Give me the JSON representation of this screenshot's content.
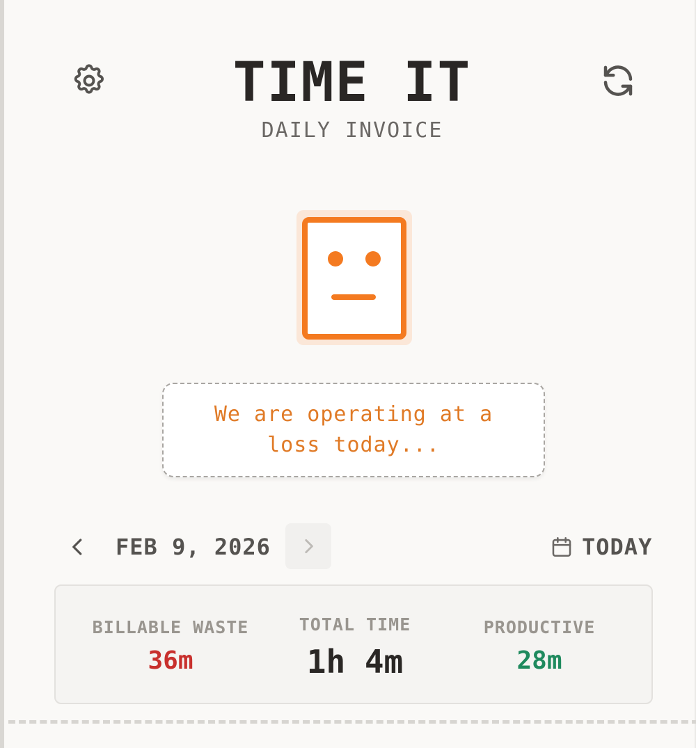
{
  "header": {
    "title": "TIME IT",
    "subtitle": "DAILY INVOICE"
  },
  "icons": {
    "settings": "gear-icon",
    "refresh": "refresh-icon",
    "prev": "chevron-left-icon",
    "next": "chevron-right-icon",
    "calendar": "calendar-icon",
    "mascot": "neutral-face-icon"
  },
  "message": "We are operating at a loss today...",
  "date_nav": {
    "date": "FEB 9, 2026",
    "today_label": "TODAY"
  },
  "stats": {
    "billable_waste": {
      "label": "BILLABLE WASTE",
      "value": "36m"
    },
    "total_time": {
      "label": "TOTAL TIME",
      "value": "1h 4m"
    },
    "productive": {
      "label": "PRODUCTIVE",
      "value": "28m"
    }
  },
  "colors": {
    "accent": "#f47a20",
    "waste": "#c8302d",
    "productive": "#1f8a5e",
    "text": "#2a2725"
  }
}
